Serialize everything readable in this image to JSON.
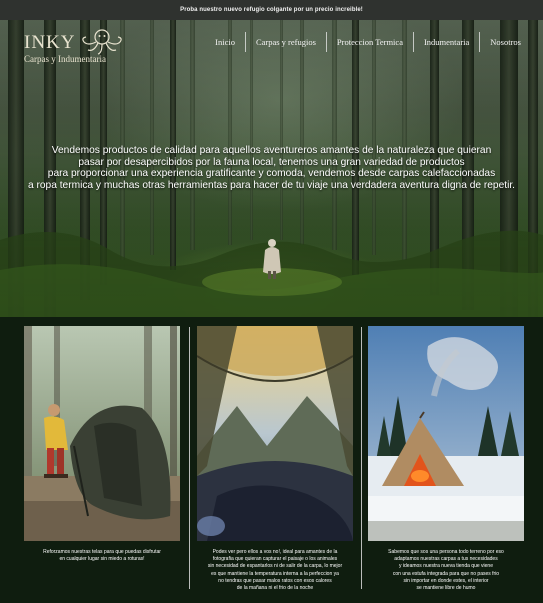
{
  "announcement": "Proba nuestro nuevo refugio colgante por un precio increible!",
  "brand": {
    "name": "INKY",
    "tagline": "Carpas y Indumentaria",
    "mark_icon": "octopus-logo-icon"
  },
  "nav": {
    "items": [
      {
        "label": "Inicio"
      },
      {
        "label": "Carpas y refugios"
      },
      {
        "label": "Proteccion Termica"
      },
      {
        "label": "Indumentaria"
      },
      {
        "label": "Nosotros"
      }
    ]
  },
  "hero": {
    "lines": [
      "Vendemos productos de calidad para aquellos aventureros amantes de la naturaleza que quieran",
      "pasar por desapercibidos por la fauna local, tenemos una gran variedad de productos",
      "para proporcionar una experiencia gratificante y comoda, vendemos desde carpas calefaccionadas",
      "a ropa termica y muchas otras herramientas para hacer de tu viaje una verdadera aventura digna de repetir."
    ]
  },
  "cards": [
    {
      "image": "photo-man-setting-up-tent",
      "lines": [
        "Reforzamos nuestras telas para que puedas disfrutar",
        "en cualquier lugar sin miedo a roturas!"
      ]
    },
    {
      "image": "photo-view-from-inside-tent",
      "lines": [
        "Podes ver pero ellos a vos no!, ideal para amantes de la",
        "fotografia que quieran capturar el paisaje o los animales",
        "sin necesidad de espantarlos ni de salir de la carpa, lo mejor",
        "es que mantiene la temperatura interna a la perfeccion ya",
        "no tendras que pasar malos ratos con esos calores",
        "de la mañana ni el frio de la noche"
      ]
    },
    {
      "image": "photo-heated-tent-in-snow",
      "lines": [
        "Sabemos que sos una persona todo terreno por eso",
        "adaptamos nuestras carpas a tus necesidades",
        "y ideamos nuestra nueva tienda que viene",
        "con una estufa integrada para que no pases frio",
        "sin importar en donde estes, el interior",
        "se mantiene libre de humo"
      ]
    }
  ],
  "colors": {
    "announcement_bg": "#2f322f",
    "section_bg": "#0f1d0f",
    "text": "#ffffff",
    "brand_text": "#e8e3cf"
  }
}
